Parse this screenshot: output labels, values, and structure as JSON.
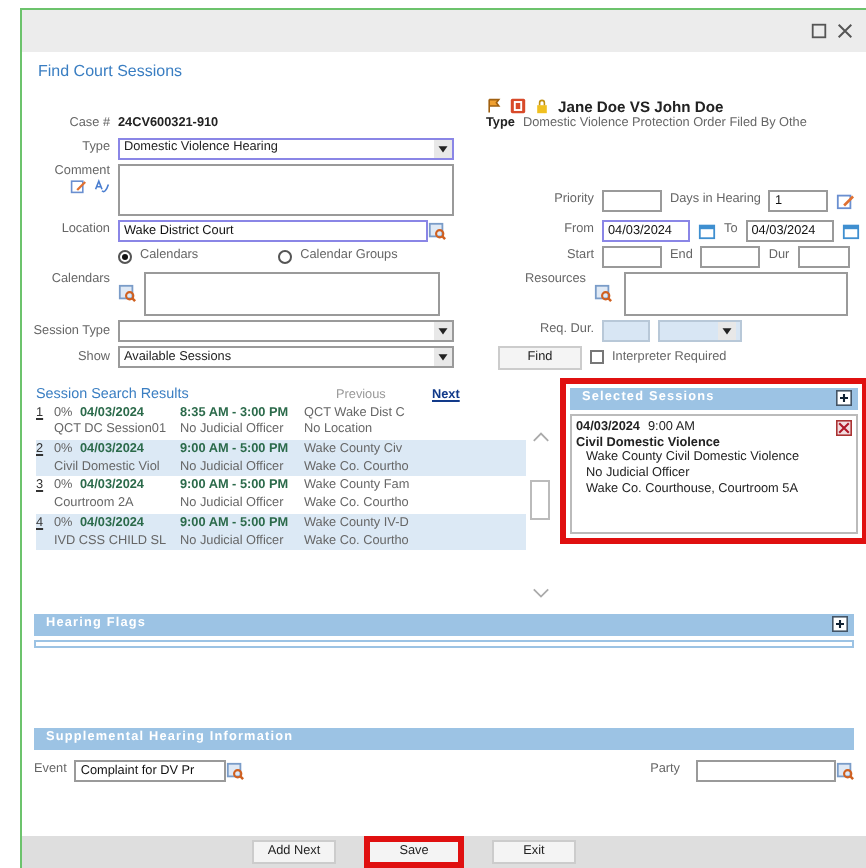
{
  "window": {
    "heading": "Find Court Sessions"
  },
  "case": {
    "parties": "Jane Doe VS John Doe",
    "number_label": "Case #",
    "number": "24CV600321-910",
    "type_label": "Type",
    "type": "Domestic Violence Protection Order Filed By Othe"
  },
  "form": {
    "type": {
      "label": "Type",
      "value": "Domestic Violence Hearing"
    },
    "comment": {
      "label": "Comment"
    },
    "priority": {
      "label": "Priority"
    },
    "days_in_hearing": {
      "label": "Days in Hearing",
      "value": "1"
    },
    "location": {
      "label": "Location",
      "value": "Wake District Court"
    },
    "from": {
      "label": "From",
      "value": "04/03/2024"
    },
    "to": {
      "label": "To",
      "value": "04/03/2024"
    },
    "calendar_mode": [
      {
        "label": "Calendars",
        "selected": true
      },
      {
        "label": "Calendar Groups",
        "selected": false
      }
    ],
    "start": {
      "label": "Start"
    },
    "end": {
      "label": "End"
    },
    "dur": {
      "label": "Dur"
    },
    "calendars": {
      "label": "Calendars"
    },
    "resources": {
      "label": "Resources"
    },
    "session_type": {
      "label": "Session Type"
    },
    "req_dur": {
      "label": "Req. Dur.",
      "disabled": true
    },
    "show": {
      "label": "Show",
      "value": "Available Sessions"
    },
    "find_button": "Find",
    "interpreter_required": {
      "label": "Interpreter Required",
      "checked": false
    }
  },
  "results": {
    "title": "Session Search Results",
    "previous": {
      "label": "Previous",
      "disabled": true
    },
    "next": {
      "label": "Next",
      "disabled": false
    },
    "rows": [
      {
        "number": "1",
        "percent": "0%",
        "date": "04/03/2024",
        "time": "8:35 AM - 3:00 PM",
        "location": "QCT Wake Dist C",
        "session": "QCT DC Session01",
        "officer": "No Judicial Officer",
        "room": "No Location"
      },
      {
        "number": "2",
        "percent": "0%",
        "date": "04/03/2024",
        "time": "9:00 AM - 5:00 PM",
        "location": "Wake County Civ",
        "session": "Civil Domestic Viol",
        "officer": "No Judicial Officer",
        "room": "Wake Co. Courtho"
      },
      {
        "number": "3",
        "percent": "0%",
        "date": "04/03/2024",
        "time": "9:00 AM - 5:00 PM",
        "location": "Wake County Fam",
        "session": "Courtroom 2A",
        "officer": "No Judicial Officer",
        "room": "Wake Co. Courtho"
      },
      {
        "number": "4",
        "percent": "0%",
        "date": "04/03/2024",
        "time": "9:00 AM - 5:00 PM",
        "location": "Wake County IV-D",
        "session": "IVD CSS CHILD SL",
        "officer": "No Judicial Officer",
        "room": "Wake Co. Courtho"
      }
    ]
  },
  "selected_sessions": {
    "title": "Selected Sessions",
    "highlighted": true,
    "items": [
      {
        "date": "04/03/2024",
        "time": "9:00 AM",
        "name": "Civil Domestic Violence",
        "details": [
          "Wake County Civil Domestic Violence",
          "No Judicial Officer",
          "Wake Co. Courthouse, Courtroom 5A"
        ]
      }
    ]
  },
  "hearing_flags": {
    "title": "Hearing Flags"
  },
  "supplemental": {
    "title": "Supplemental Hearing Information",
    "event": {
      "label": "Event",
      "value": "Complaint for DV Pr"
    },
    "party": {
      "label": "Party"
    }
  },
  "buttons": [
    {
      "label": "Add Next",
      "highlighted": false
    },
    {
      "label": "Save",
      "highlighted": true
    },
    {
      "label": "Exit",
      "highlighted": false
    }
  ]
}
